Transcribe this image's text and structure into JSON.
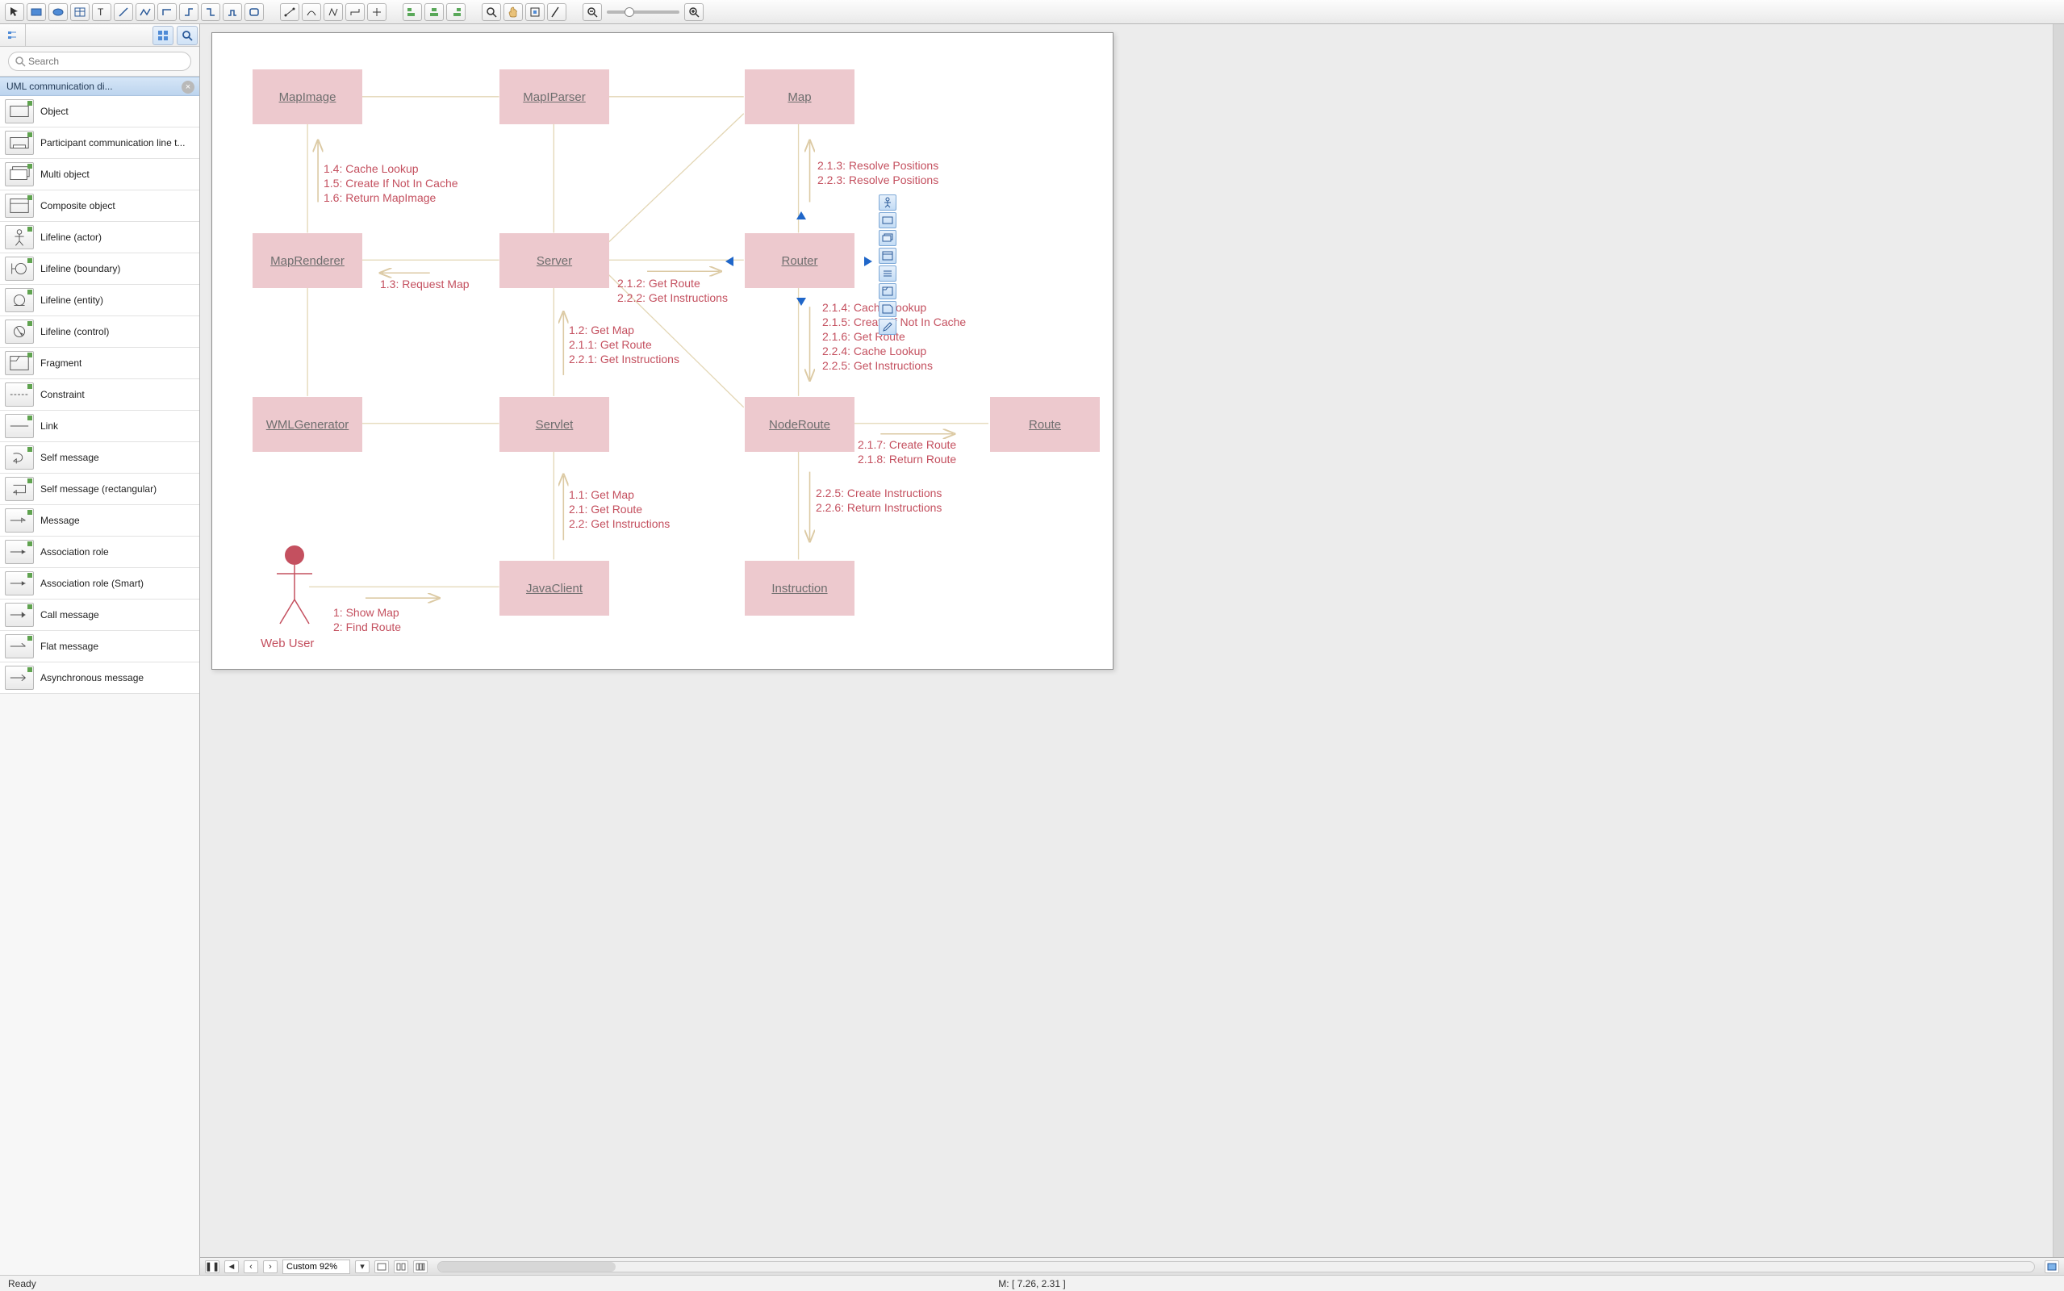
{
  "toolbar": {
    "groups": [
      [
        "pointer",
        "rectangle",
        "ellipse",
        "table",
        "text",
        "line",
        "polyline",
        "ortho-step",
        "ortho-cross",
        "ortho-round",
        "ortho-bezier",
        "rounded-rect"
      ],
      [
        "connector-diag",
        "connector-curve",
        "connector-poly",
        "connector-ortho",
        "connector-cross"
      ],
      [
        "align-left",
        "align-center",
        "align-right"
      ],
      [
        "zoom-in",
        "pan",
        "fit",
        "crop"
      ],
      [
        "zoom-out-small",
        "zoom-slider",
        "zoom-in-small"
      ]
    ]
  },
  "palette": {
    "search_placeholder": "Search",
    "section_title": "UML communication di...",
    "items": [
      "Object",
      "Participant communication line t...",
      "Multi object",
      "Composite object",
      "Lifeline (actor)",
      "Lifeline (boundary)",
      "Lifeline (entity)",
      "Lifeline (control)",
      "Fragment",
      "Constraint",
      "Link",
      "Self message",
      "Self message (rectangular)",
      "Message",
      "Association role",
      "Association role (Smart)",
      "Call message",
      "Flat message",
      "Asynchronous message"
    ]
  },
  "diagram": {
    "actor": "Web User",
    "nodes": {
      "MapImage": "MapImage",
      "MapIParser": "MapIParser",
      "Map": "Map",
      "MapRenderer": "MapRenderer",
      "Server": "Server",
      "Router": "Router",
      "WMLGenerator": "WMLGenerator",
      "Servlet": "Servlet",
      "NodeRoute": "NodeRoute",
      "Route": "Route",
      "JavaClient": "JavaClient",
      "Instruction": "Instruction"
    },
    "messages": {
      "m_actor_client": "1: Show Map\n2: Find Route",
      "m_client_servlet": "1.1: Get Map\n2.1: Get Route\n2.2: Get Instructions",
      "m_servlet_server": "1.2: Get Map\n2.1.1: Get Route\n2.2.1: Get Instructions",
      "m_server_renderer": "1.3: Request Map",
      "m_renderer_image": "1.4: Cache Lookup\n1.5: Create If Not In Cache\n1.6: Return MapImage",
      "m_server_router": "2.1.2: Get Route\n2.2.2: Get Instructions",
      "m_router_map": "2.1.3: Resolve Positions\n2.2.3: Resolve Positions",
      "m_router_noderoute": "2.1.4: Cache Lookup\n2.1.5: Create If Not In Cache\n2.1.6: Get Route\n2.2.4: Cache Lookup\n2.2.5: Get Instructions",
      "m_noderoute_route": "2.1.7: Create Route\n2.1.8: Return Route",
      "m_noderoute_instruction": "2.2.5: Create Instructions\n2.2.6: Return Instructions"
    }
  },
  "bottombar": {
    "zoom_label": "Custom 92%"
  },
  "status": {
    "ready": "Ready",
    "mouse": "M: [ 7.26, 2.31 ]"
  }
}
